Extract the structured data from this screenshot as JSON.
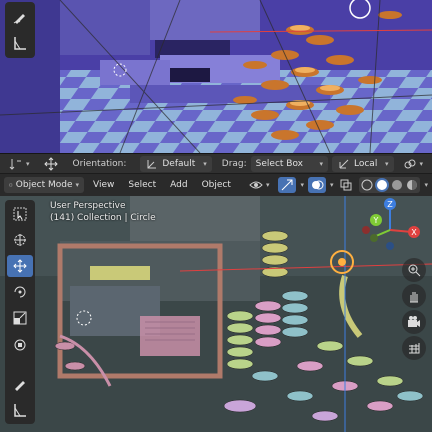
{
  "tool_header": {
    "orientation_label": "Orientation:",
    "orientation_value": "Default",
    "drag_label": "Drag:",
    "drag_value": "Select Box",
    "pivot_value": "Local"
  },
  "viewport_header": {
    "mode_value": "Object Mode",
    "menus": [
      "View",
      "Select",
      "Add",
      "Object"
    ]
  },
  "viewport_overlay": {
    "view_name": "User Perspective",
    "collection_info": "(141) Collection | Circle"
  },
  "gizmo": {
    "axes": [
      "X",
      "Y",
      "Z"
    ],
    "colors": {
      "x": "#e0413f",
      "y": "#7fcb35",
      "z": "#3d7ee0"
    }
  },
  "toolbar": {
    "tools": [
      "select-box",
      "cursor",
      "move",
      "rotate",
      "scale",
      "transform",
      "annotate",
      "measure"
    ],
    "active_tool": "move"
  },
  "colors": {
    "accent": "#4772b3",
    "header_bg": "#303030",
    "floor_checker_a": "#6b67c8",
    "floor_checker_b": "#8fb3d8",
    "coin_orange": "#c9752c"
  }
}
